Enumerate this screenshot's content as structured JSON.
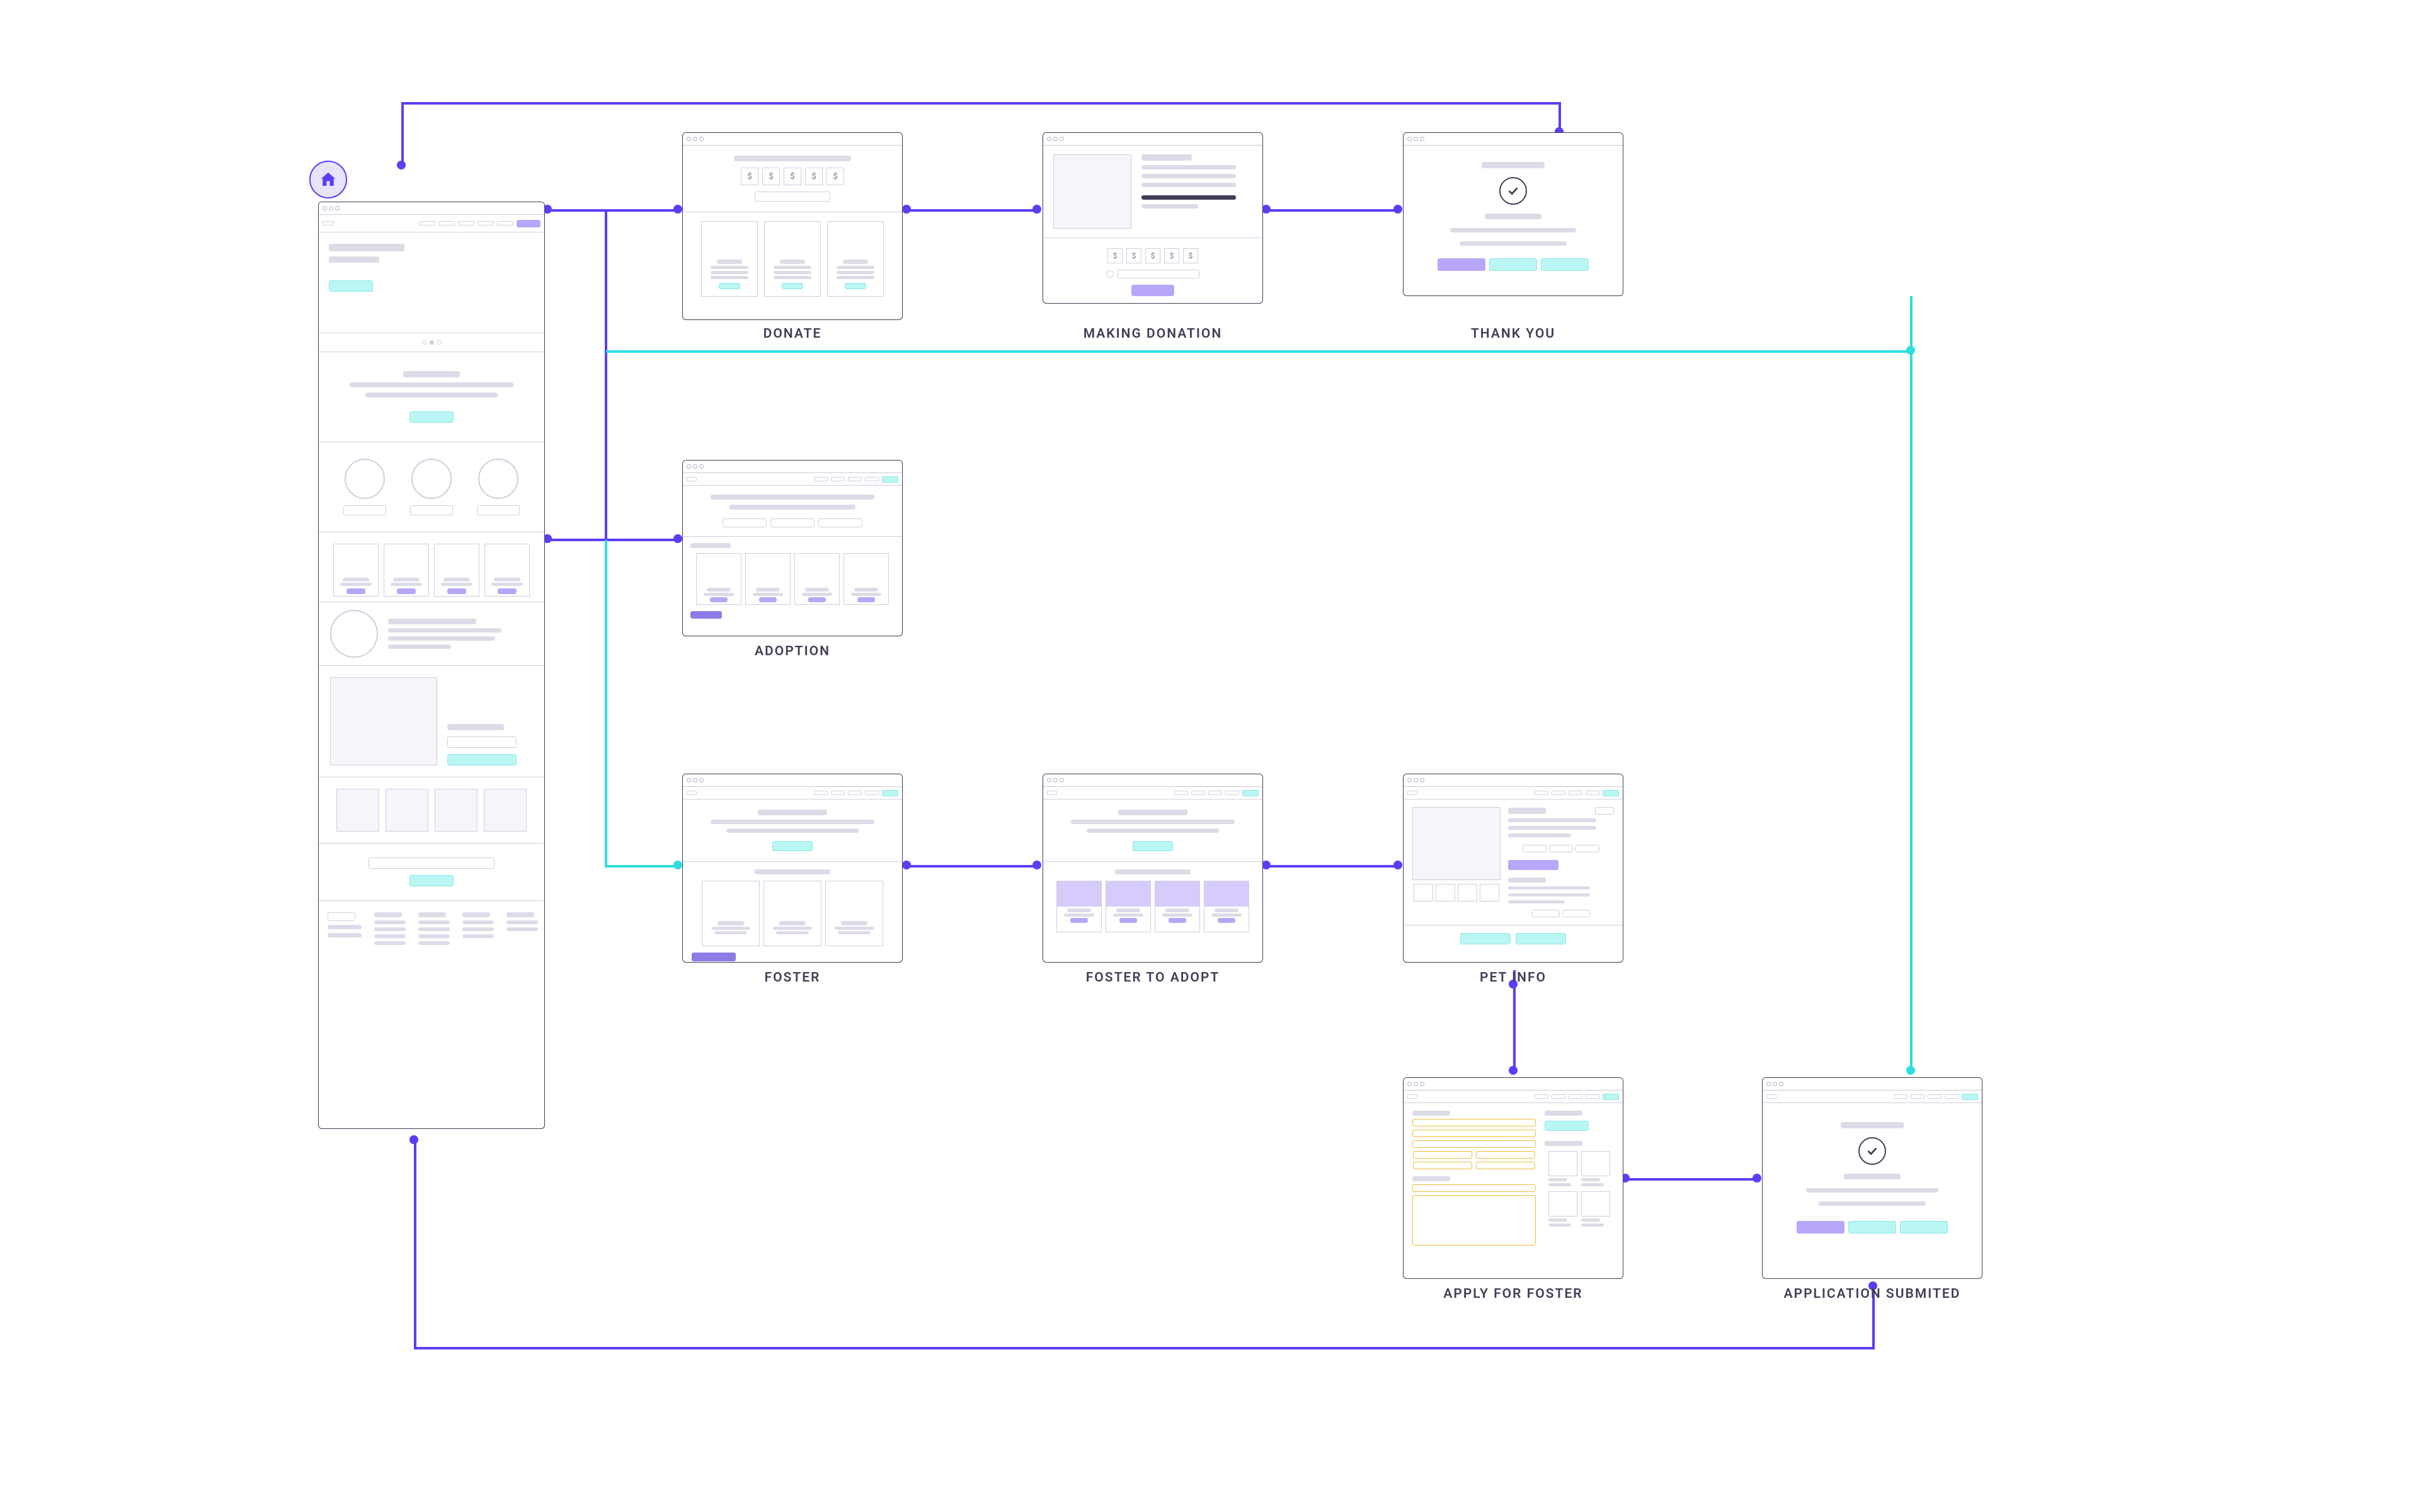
{
  "labels": {
    "donate": "DONATE",
    "making_donation": "MAKING DONATION",
    "thank_you": "THANK YOU",
    "adoption": "ADOPTION",
    "foster": "FOSTER",
    "foster_to_adopt": "FOSTER TO ADOPT",
    "pet_info": "PET INFO",
    "apply_for_foster": "APPLY FOR FOSTER",
    "application_submited": "APPLICATION SUBMITED"
  },
  "dollar": "$",
  "colors": {
    "purple": "#5B3DF6",
    "cyan": "#2FDDDF",
    "purple_light": "#B8A7F8",
    "cyan_light": "#B9F6F4",
    "outline": "#3F3F56"
  }
}
